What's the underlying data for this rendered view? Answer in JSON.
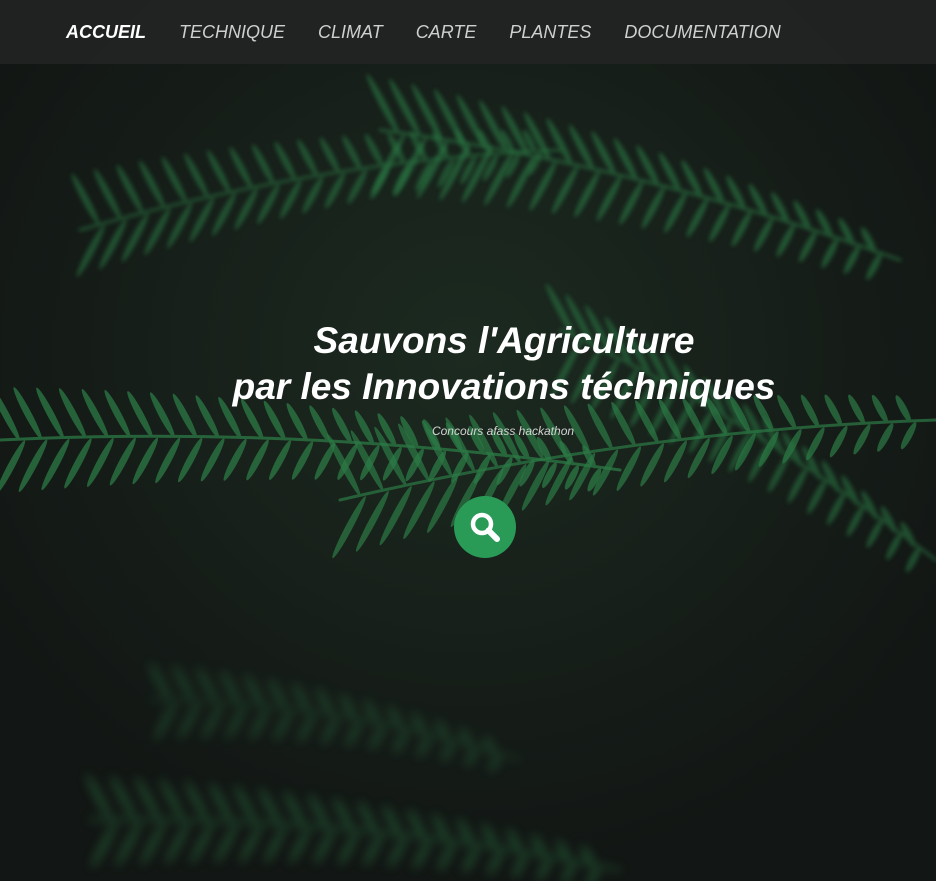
{
  "nav": {
    "items": [
      {
        "label": "ACCUEIL",
        "active": true
      },
      {
        "label": "TECHNIQUE",
        "active": false
      },
      {
        "label": "CLIMAT",
        "active": false
      },
      {
        "label": "CARTE",
        "active": false
      },
      {
        "label": "PLANTES",
        "active": false
      },
      {
        "label": "DOCUMENTATION",
        "active": false
      }
    ]
  },
  "hero": {
    "title_line1": "Sauvons l'Agriculture",
    "title_line2": "par les Innovations téchniques",
    "subtitle": "Concours afass hackathon",
    "search_icon": "search-icon"
  },
  "colors": {
    "accent": "#2a9a57",
    "navbar_bg": "#222423",
    "background": "#141816",
    "fern": "#2f7a45"
  }
}
